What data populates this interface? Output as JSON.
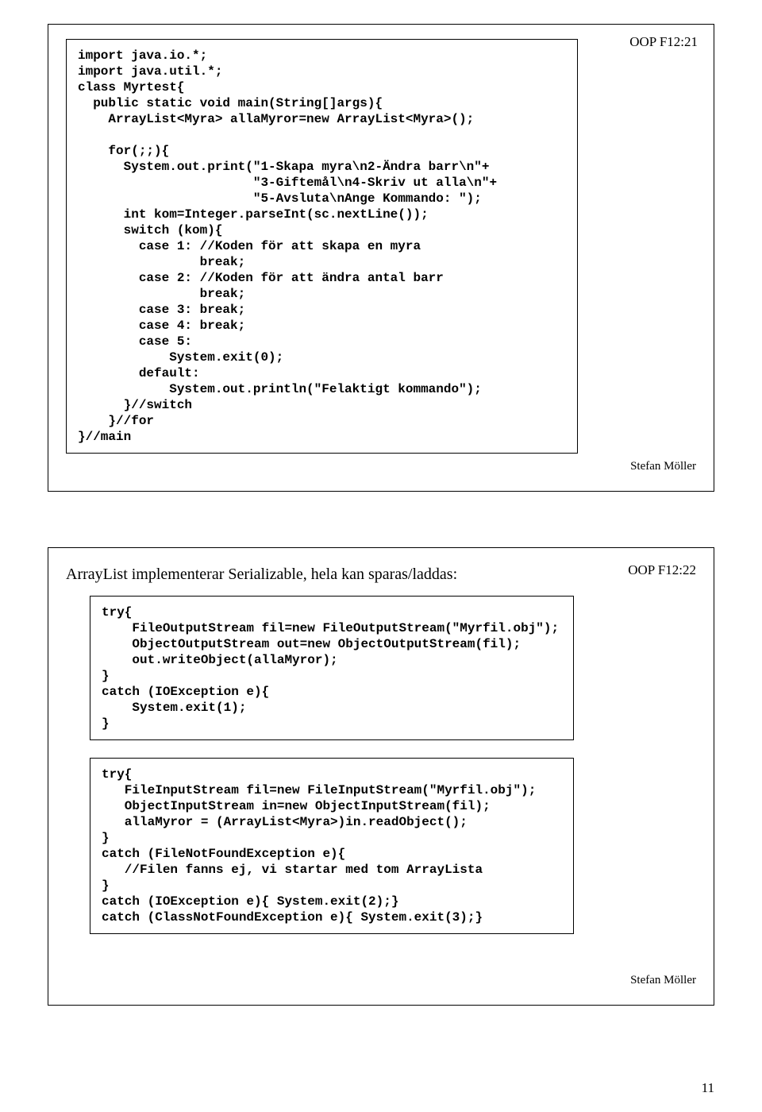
{
  "slide1": {
    "label": "OOP F12:21",
    "author": "Stefan Möller",
    "code": "import java.io.*;\nimport java.util.*;\nclass Myrtest{\n  public static void main(String[]args){\n    ArrayList<Myra> allaMyror=new ArrayList<Myra>();\n\n    for(;;){\n      System.out.print(\"1-Skapa myra\\n2-Ändra barr\\n\"+\n                       \"3-Giftemål\\n4-Skriv ut alla\\n\"+\n                       \"5-Avsluta\\nAnge Kommando: \");\n      int kom=Integer.parseInt(sc.nextLine());\n      switch (kom){\n        case 1: //Koden för att skapa en myra\n                break;\n        case 2: //Koden för att ändra antal barr\n                break;\n        case 3: break;\n        case 4: break;\n        case 5:\n            System.exit(0);\n        default:\n            System.out.println(\"Felaktigt kommando\");\n      }//switch\n    }//for\n}//main"
  },
  "slide2": {
    "label": "OOP F12:22",
    "title": "ArrayList implementerar Serializable, hela kan sparas/laddas:",
    "author": "Stefan Möller",
    "code1": "try{\n    FileOutputStream fil=new FileOutputStream(\"Myrfil.obj\");\n    ObjectOutputStream out=new ObjectOutputStream(fil);\n    out.writeObject(allaMyror);\n}\ncatch (IOException e){\n    System.exit(1);\n}",
    "code2": "try{\n   FileInputStream fil=new FileInputStream(\"Myrfil.obj\");\n   ObjectInputStream in=new ObjectInputStream(fil);\n   allaMyror = (ArrayList<Myra>)in.readObject();\n}\ncatch (FileNotFoundException e){\n   //Filen fanns ej, vi startar med tom ArrayLista\n}\ncatch (IOException e){ System.exit(2);}\ncatch (ClassNotFoundException e){ System.exit(3);}"
  },
  "page_number": "11"
}
